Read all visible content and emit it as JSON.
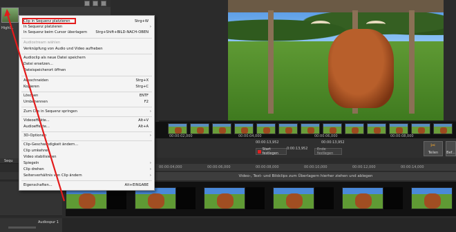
{
  "pool": {
    "thumb_label": "Highl..."
  },
  "controls": {
    "time_a": "00:00:13,952",
    "time_b": "00:00:13,952",
    "time_c": "0:00:13,952",
    "start_mark": "Start festlegen",
    "end_mark": "Ende festlegen",
    "split": "Teilen",
    "extra": "Bef..."
  },
  "filmstrip_ticks": [
    "00:00:02,000",
    "00:00:04,000",
    "00:00:06,000",
    "00:00:08,000"
  ],
  "ruler_ticks": [
    "00:00:04,000",
    "00:00:06,000",
    "00:00:08,000",
    "00:00:10,000",
    "00:00:12,000",
    "00:00:14,000"
  ],
  "overlay_hint": "Video-, Text- und Bildclips zum Überlagern hierher ziehen und ablegen",
  "tracks": {
    "top_tab": "Sequ",
    "audio_label": "Audiospur 1"
  },
  "menu": {
    "items": [
      {
        "label": "Clip in Sequenz platzieren",
        "shortcut": "Strg+W",
        "disabled": false,
        "arrow": false
      },
      {
        "label": "In Sequenz platzieren",
        "shortcut": "",
        "disabled": false,
        "arrow": true
      },
      {
        "label": "In Sequenz beim Cursor überlagern",
        "shortcut": "Strg+Shift+BILD-NACH-OBEN",
        "disabled": false,
        "arrow": false
      },
      {
        "label": "Audiostream wählen",
        "shortcut": "",
        "disabled": true,
        "arrow": false
      },
      {
        "label": "Verknüpfung von Audio und Video aufheben",
        "shortcut": "",
        "disabled": false,
        "arrow": false
      },
      {
        "label": "Audioclip als neue Datei speichern",
        "shortcut": "",
        "disabled": false,
        "arrow": false
      },
      {
        "label": "Datei ersetzen...",
        "shortcut": "",
        "disabled": false,
        "arrow": false
      },
      {
        "label": "Dateispeicherort öffnen",
        "shortcut": "",
        "disabled": false,
        "arrow": false
      },
      {
        "label": "Ausschneiden",
        "shortcut": "Strg+X",
        "disabled": false,
        "arrow": false
      },
      {
        "label": "Kopieren",
        "shortcut": "Strg+C",
        "disabled": false,
        "arrow": false
      },
      {
        "label": "Löschen",
        "shortcut": "ENTF",
        "disabled": false,
        "arrow": false
      },
      {
        "label": "Umbenennen",
        "shortcut": "F2",
        "disabled": false,
        "arrow": false
      },
      {
        "label": "Zum Clip in Sequenz springen",
        "shortcut": "",
        "disabled": false,
        "arrow": true
      },
      {
        "label": "Videoeffekte...",
        "shortcut": "Alt+V",
        "disabled": false,
        "arrow": false
      },
      {
        "label": "Audioeffekte...",
        "shortcut": "Alt+A",
        "disabled": false,
        "arrow": false
      },
      {
        "label": "3D-Optionen",
        "shortcut": "",
        "disabled": false,
        "arrow": true
      },
      {
        "label": "Clip-Geschwindigkeit ändern...",
        "shortcut": "",
        "disabled": false,
        "arrow": false
      },
      {
        "label": "Clip umkehren",
        "shortcut": "",
        "disabled": false,
        "arrow": false
      },
      {
        "label": "Video stabilisieren",
        "shortcut": "",
        "disabled": false,
        "arrow": false
      },
      {
        "label": "Spiegeln",
        "shortcut": "",
        "disabled": false,
        "arrow": true
      },
      {
        "label": "Clip drehen",
        "shortcut": "",
        "disabled": false,
        "arrow": true
      },
      {
        "label": "Seitenverhältnis von Clip ändern",
        "shortcut": "",
        "disabled": false,
        "arrow": true
      },
      {
        "label": "Eigenschaften...",
        "shortcut": "Alt+EINGABE",
        "disabled": false,
        "arrow": false
      }
    ]
  }
}
